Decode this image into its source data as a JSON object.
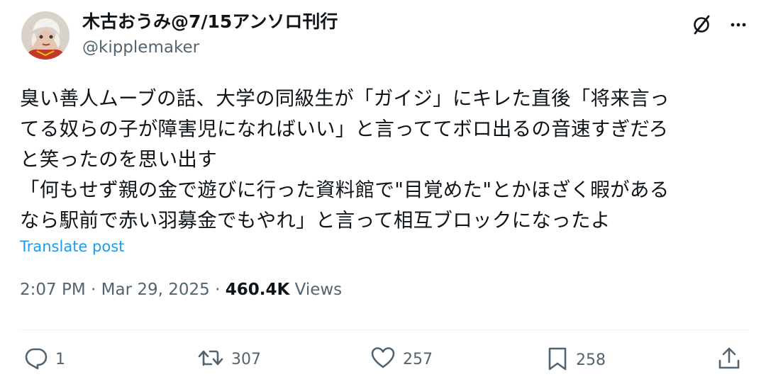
{
  "author": {
    "display_name": "木古おうみ@7/15アンソロ刊行",
    "handle": "@kipplemaker"
  },
  "post": {
    "lines": [
      "臭い善人ムーブの話、大学の同級生が「ガイジ」にキレた直後「将来言っ",
      "てる奴らの子が障害児になればいい」と言っててボロ出るの音速すぎだろ",
      "と笑ったのを思い出す",
      "「何もせず親の金で遊びに行った資料館で\"目覚めた\"とかほざく暇がある",
      "なら駅前で赤い羽募金でもやれ」と言って相互ブロックになったよ"
    ],
    "translate_label": "Translate post"
  },
  "meta": {
    "time": "2:07 PM",
    "separator": " · ",
    "date": "Mar 29, 2025",
    "views_count": "460.4K",
    "views_label": " Views"
  },
  "actions": {
    "reply_count": "1",
    "repost_count": "307",
    "like_count": "257",
    "bookmark_count": "258"
  },
  "icons": {
    "grok": "grok-icon",
    "more": "more-icon",
    "reply": "reply-icon",
    "repost": "repost-icon",
    "like": "heart-icon",
    "bookmark": "bookmark-icon",
    "share": "share-icon"
  },
  "colors": {
    "text": "#0f1419",
    "secondary": "#536471",
    "link": "#1d9bf0",
    "divider": "#eff3f4"
  }
}
